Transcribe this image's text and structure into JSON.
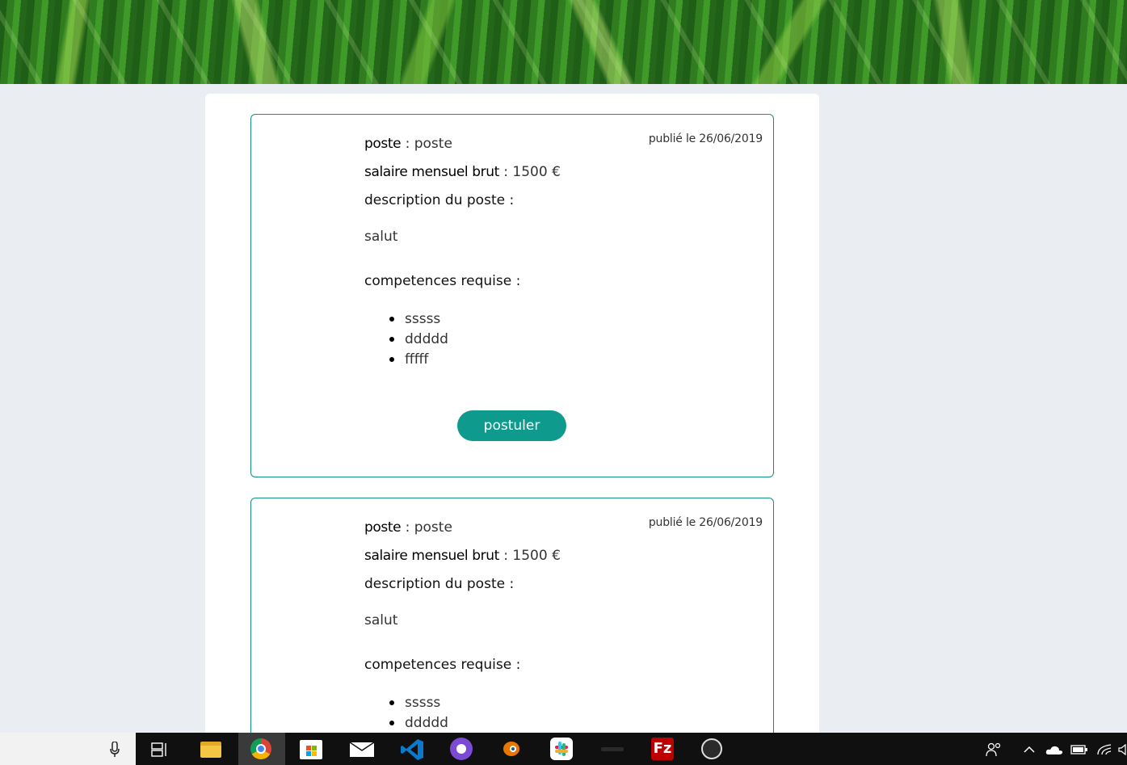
{
  "offers": [
    {
      "date": "publié le 26/06/2019",
      "poste_label": "poste",
      "poste_value": "poste",
      "salaire_label": "salaire mensuel brut",
      "salaire_value": "1500 €",
      "description_label": "description du poste :",
      "description_text": "salut",
      "competences_label": "competences requise :",
      "competences": [
        "sssss",
        "ddddd",
        "fffff"
      ],
      "apply_label": "postuler"
    },
    {
      "date": "publié le 26/06/2019",
      "poste_label": "poste",
      "poste_value": "poste",
      "salaire_label": "salaire mensuel brut",
      "salaire_value": "1500 €",
      "description_label": "description du poste :",
      "description_text": "salut",
      "competences_label": "competences requise :",
      "competences": [
        "sssss",
        "ddddd"
      ]
    }
  ],
  "taskbar": {
    "icons": [
      "microphone-icon",
      "task-view-icon",
      "file-explorer-icon",
      "chrome-icon",
      "store-icon",
      "mail-icon",
      "vscode-icon",
      "github-desktop-icon",
      "blender-icon",
      "slack-icon",
      "app-icon",
      "filezilla-icon",
      "obs-icon"
    ],
    "tray": [
      "people-icon",
      "chevron-up-icon",
      "onedrive-icon",
      "battery-icon",
      "wifi-icon",
      "volume-icon"
    ]
  },
  "colors": {
    "accent": "#0e9a8c",
    "card_border": "#11918a",
    "page_bg": "#eaeef2"
  }
}
